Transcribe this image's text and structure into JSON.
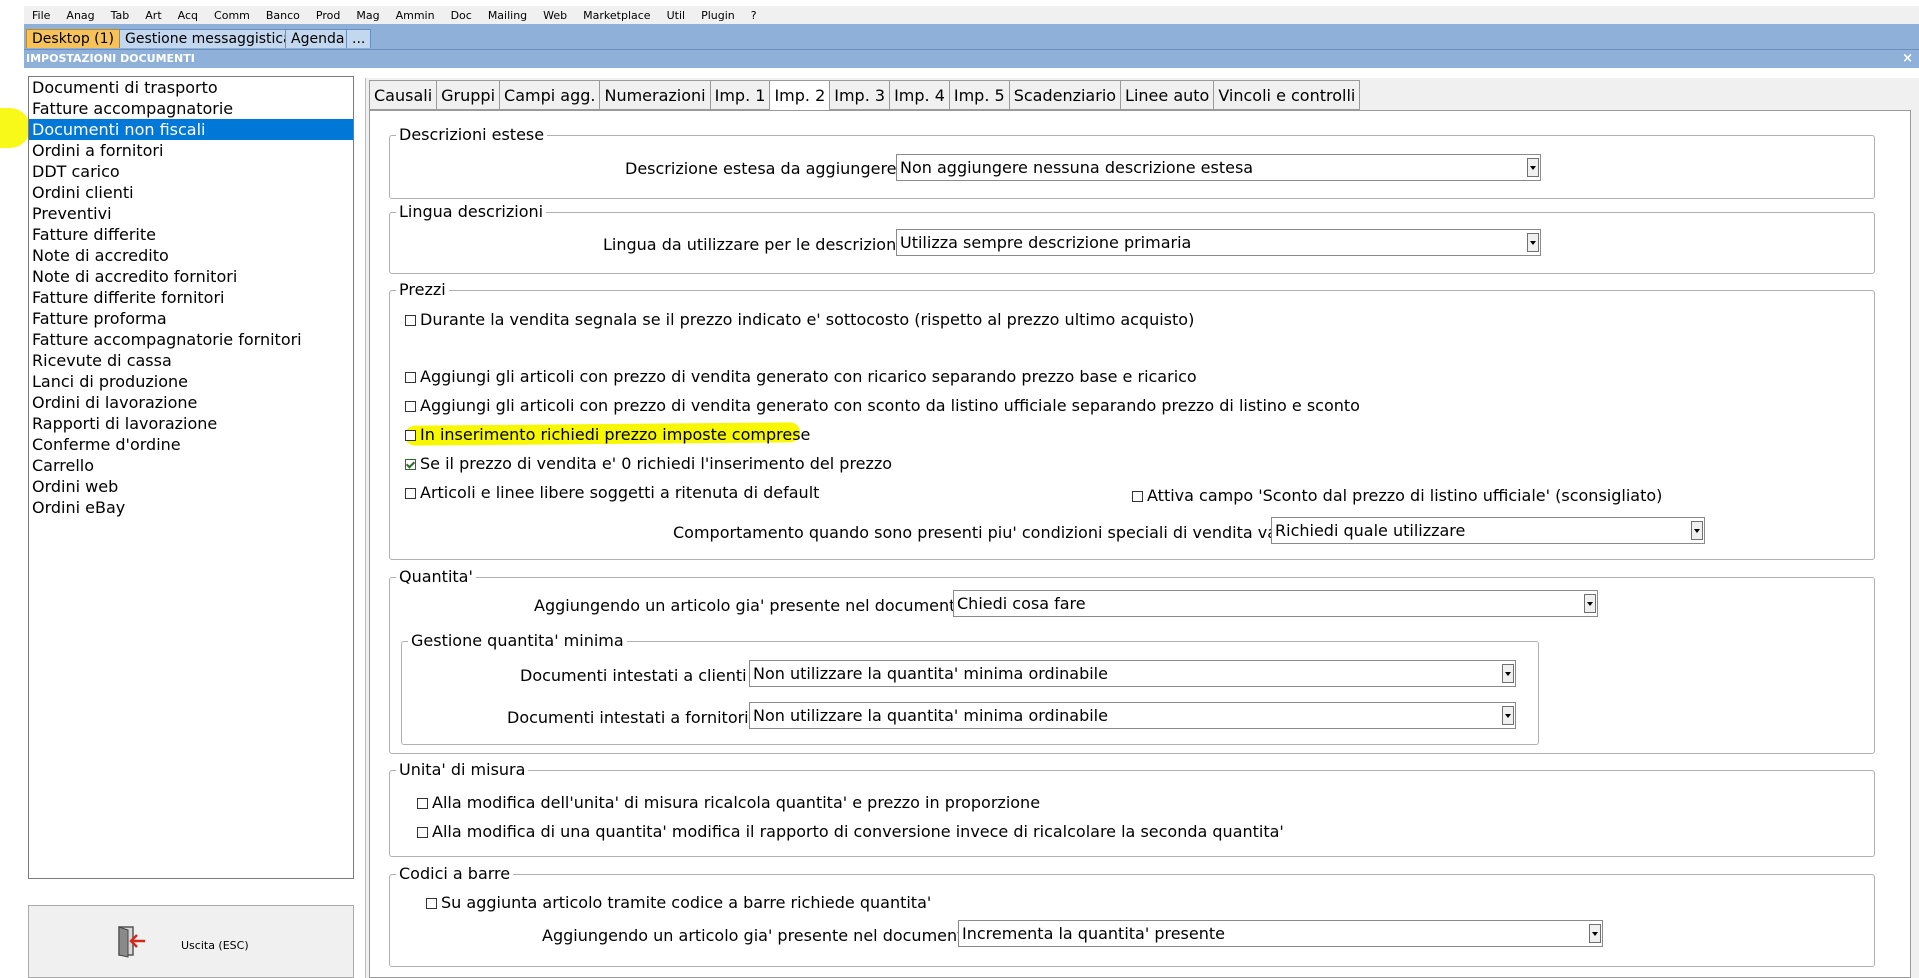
{
  "menu": [
    "File",
    "Anag",
    "Tab",
    "Art",
    "Acq",
    "Comm",
    "Banco",
    "Prod",
    "Mag",
    "Ammin",
    "Doc",
    "Mailing",
    "Web",
    "Marketplace",
    "Util",
    "Plugin",
    "?"
  ],
  "app_tabs": [
    "Desktop (1)",
    "Gestione messaggistica",
    "Agenda",
    "..."
  ],
  "window_title": "IMPOSTAZIONI DOCUMENTI",
  "close_glyph": "×",
  "document_types": [
    "Documenti di trasporto",
    "Fatture accompagnatorie",
    "Documenti non fiscali",
    "Ordini a fornitori",
    "DDT carico",
    "Ordini clienti",
    "Preventivi",
    "Fatture differite",
    "Note di accredito",
    "Note di accredito fornitori",
    "Fatture differite fornitori",
    "Fatture proforma",
    "Fatture accompagnatorie fornitori",
    "Ricevute di cassa",
    "Lanci di produzione",
    "Ordini di lavorazione",
    "Rapporti di lavorazione",
    "Conferme d'ordine",
    "Carrello",
    "Ordini web",
    "Ordini eBay"
  ],
  "selected_document_type": "Documenti non fiscali",
  "exit_label": "Uscita (ESC)",
  "settings_tabs": [
    "Causali",
    "Gruppi",
    "Campi agg.",
    "Numerazioni",
    "Imp. 1",
    "Imp. 2",
    "Imp. 3",
    "Imp. 4",
    "Imp. 5",
    "Scadenziario",
    "Linee auto",
    "Vincoli e controlli"
  ],
  "active_settings_tab": "Imp. 2",
  "descrizioni_estese": {
    "title": "Descrizioni estese",
    "label": "Descrizione estesa da aggiungere :",
    "value": "Non aggiungere nessuna descrizione estesa"
  },
  "lingua_descrizioni": {
    "title": "Lingua descrizioni",
    "label": "Lingua da utilizzare per le descrizioni :",
    "value": "Utilizza sempre descrizione primaria"
  },
  "prezzi": {
    "title": "Prezzi",
    "checkboxes": [
      {
        "label": "Durante la vendita segnala se il prezzo indicato e' sottocosto (rispetto al prezzo ultimo acquisto)",
        "checked": false
      },
      {
        "label": "Aggiungi gli articoli con prezzo di vendita generato con ricarico separando prezzo base e ricarico",
        "checked": false
      },
      {
        "label": "Aggiungi gli articoli con prezzo di vendita generato con sconto da listino ufficiale separando prezzo di listino e sconto",
        "checked": false
      },
      {
        "label": "In inserimento richiedi prezzo imposte comprese",
        "checked": false
      },
      {
        "label": "Se il prezzo di vendita e' 0 richiedi l'inserimento del prezzo",
        "checked": true
      },
      {
        "label": "Articoli e linee libere soggetti a ritenuta di default",
        "checked": false
      },
      {
        "label": "Attiva campo 'Sconto dal prezzo di listino ufficiale' (sconsigliato)",
        "checked": false
      }
    ],
    "conditions_label": "Comportamento quando sono presenti piu' condizioni speciali di vendita valide :",
    "conditions_value": "Richiedi quale utilizzare"
  },
  "quantita": {
    "title": "Quantita'",
    "label": "Aggiungendo un articolo gia' presente nel documento :",
    "value": "Chiedi cosa fare",
    "minima": {
      "title": "Gestione quantita' minima",
      "clienti_label": "Documenti intestati a clienti :",
      "clienti_value": "Non utilizzare la quantita' minima ordinabile",
      "fornitori_label": "Documenti intestati a fornitori :",
      "fornitori_value": "Non utilizzare la quantita' minima ordinabile"
    }
  },
  "unita_misura": {
    "title": "Unita' di misura",
    "checkboxes": [
      {
        "label": "Alla modifica dell'unita' di misura ricalcola quantita' e prezzo in proporzione",
        "checked": false
      },
      {
        "label": "Alla modifica di una quantita' modifica il rapporto di conversione invece di ricalcolare la seconda quantita'",
        "checked": false
      }
    ]
  },
  "codici_barre": {
    "title": "Codici a barre",
    "checkbox": {
      "label": "Su aggiunta articolo tramite codice a barre richiede quantita'",
      "checked": false
    },
    "label": "Aggiungendo un articolo gia' presente nel documento :",
    "value": "Incrementa la quantita' presente"
  },
  "colors": {
    "selection": "#0078d7",
    "highlighter": "#f7f700",
    "active_app_tab": "#f7c25a",
    "title_bar": "#8fb1d9"
  }
}
